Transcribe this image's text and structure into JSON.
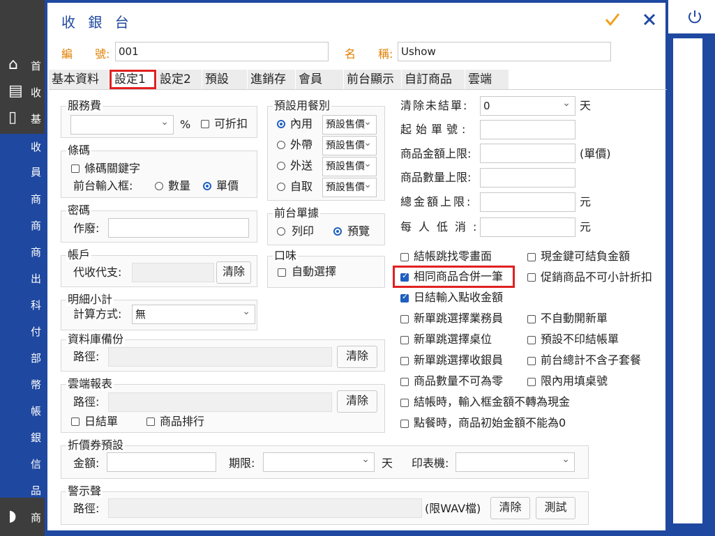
{
  "sidebar": {
    "items": [
      "首",
      "收",
      "基",
      "收",
      "員",
      "商",
      "商",
      "商",
      "出",
      "科",
      "付",
      "部",
      "幣",
      "帳",
      "銀",
      "信",
      "品",
      "商"
    ]
  },
  "dialog": {
    "title": "收 銀 台",
    "confirm_icon": "check-icon",
    "close_icon": "close-icon"
  },
  "header": {
    "code_label": "編　　號:",
    "code_value": "001",
    "name_label": "名　　稱:",
    "name_value": "Ushow"
  },
  "tabs": [
    "基本資料",
    "設定1",
    "設定2",
    "預設",
    "進銷存",
    "會員",
    "前台顯示",
    "自訂商品",
    "雲端"
  ],
  "service_fee": {
    "title": "服務費",
    "unit": "%",
    "discountable": "可折扣"
  },
  "barcode": {
    "title": "條碼",
    "keyword": "條碼關鍵字",
    "input_label": "前台輸入框:",
    "opt_qty": "數量",
    "opt_price": "單價"
  },
  "password": {
    "title": "密碼",
    "void_label": "作廢:"
  },
  "account": {
    "title": "帳戶",
    "label": "代收代支:",
    "clear": "清除"
  },
  "subtotal": {
    "title": "明細小計",
    "label": "計算方式:",
    "value": "無"
  },
  "backup": {
    "title": "資料庫備份",
    "label": "路徑:",
    "clear": "清除"
  },
  "cloud_report": {
    "title": "雲端報表",
    "label": "路徑:",
    "clear": "清除",
    "daily": "日結單",
    "ranking": "商品排行"
  },
  "meal": {
    "title": "預設用餐別",
    "items": [
      {
        "label": "內用",
        "sel": "預設售價"
      },
      {
        "label": "外帶",
        "sel": "預設售價"
      },
      {
        "label": "外送",
        "sel": "預設售價"
      },
      {
        "label": "自取",
        "sel": "預設售價"
      }
    ]
  },
  "receipt": {
    "title": "前台單據",
    "print": "列印",
    "preview": "預覽"
  },
  "flavor": {
    "title": "口味",
    "auto": "自動選擇"
  },
  "right": {
    "clear_label": "清除未結單:",
    "clear_value": "0",
    "clear_unit": "天",
    "start_no": "起始單號:",
    "price_limit": "商品金額上限:",
    "price_unit": "(單價)",
    "qty_limit": "商品數量上限:",
    "total_limit": "總金額上限:",
    "total_unit": "元",
    "min_spend": "每人低消:",
    "min_unit": "元"
  },
  "checks": [
    {
      "label": "結帳跳找零畫面",
      "on": false
    },
    {
      "label": "現金鍵可結負金額",
      "on": false
    },
    {
      "label": "相同商品合併一筆",
      "on": true
    },
    {
      "label": "促銷商品不可小計折扣",
      "on": false
    },
    {
      "label": "日結輸入點收金額",
      "on": true
    },
    {
      "label": "新單跳選擇業務員",
      "on": false
    },
    {
      "label": "不自動開新單",
      "on": false
    },
    {
      "label": "新單跳選擇桌位",
      "on": false
    },
    {
      "label": "預設不印結帳單",
      "on": false
    },
    {
      "label": "新單跳選擇收銀員",
      "on": false
    },
    {
      "label": "前台總計不含子套餐",
      "on": false
    },
    {
      "label": "商品數量不可為零",
      "on": false
    },
    {
      "label": "限內用填桌號",
      "on": false
    },
    {
      "label": "結帳時，輸入框金額不轉為現金",
      "on": false
    },
    {
      "label": "點餐時，商品初始金額不能為0",
      "on": false
    }
  ],
  "coupon": {
    "title": "折價券預設",
    "amount": "金額:",
    "period": "期限:",
    "unit": "天",
    "printer": "印表機:"
  },
  "alert": {
    "title": "警示聲",
    "label": "路徑:",
    "note": "(限WAV檔)",
    "clear": "清除",
    "test": "測試"
  },
  "colors": {
    "accent": "#1f48a0",
    "highlight": "#e02020",
    "orange": "#e08000"
  }
}
